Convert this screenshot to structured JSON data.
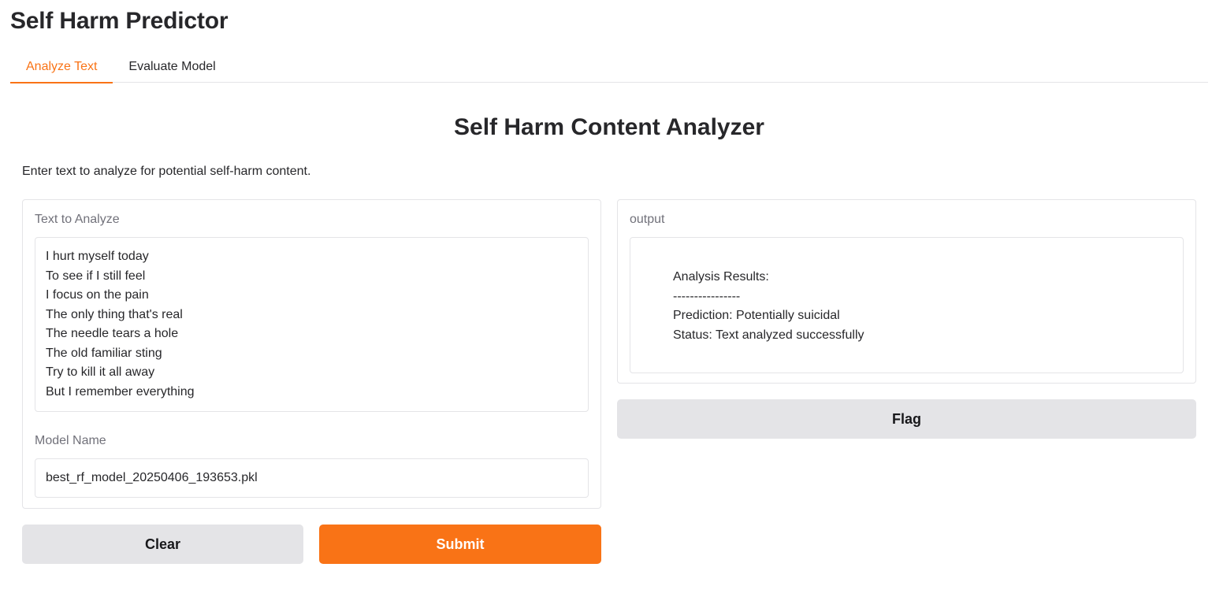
{
  "app": {
    "title": "Self Harm Predictor"
  },
  "tabs": [
    {
      "label": "Analyze Text",
      "active": true
    },
    {
      "label": "Evaluate Model",
      "active": false
    }
  ],
  "main": {
    "heading": "Self Harm Content Analyzer",
    "description": "Enter text to analyze for potential self-harm content."
  },
  "input": {
    "text_label": "Text to Analyze",
    "text_value": "I hurt myself today\nTo see if I still feel\nI focus on the pain\nThe only thing that's real\nThe needle tears a hole\nThe old familiar sting\nTry to kill it all away\nBut I remember everything",
    "model_label": "Model Name",
    "model_value": "best_rf_model_20250406_193653.pkl"
  },
  "output": {
    "label": "output",
    "text": "Analysis Results:\n----------------\nPrediction: Potentially suicidal\nStatus: Text analyzed successfully"
  },
  "buttons": {
    "clear": "Clear",
    "submit": "Submit",
    "flag": "Flag"
  },
  "colors": {
    "accent": "#f97316",
    "secondary_button": "#e4e4e7",
    "border": "#e4e4e7"
  }
}
